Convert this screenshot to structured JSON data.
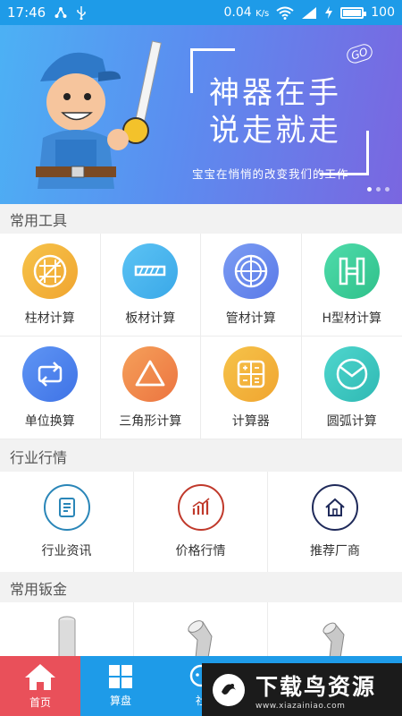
{
  "status_bar": {
    "time": "17:46",
    "speed": "0.04",
    "speed_unit": "K/s",
    "battery": "100"
  },
  "banner": {
    "headline_1": "神器在手",
    "headline_2": "说走就走",
    "tag": "GO",
    "subtitle": "宝宝在悄悄的改变我们的工作"
  },
  "sections": {
    "common_tools": "常用工具",
    "industry_market": "行业行情",
    "common_sheet_metal": "常用钣金"
  },
  "tools": [
    {
      "label": "柱材计算",
      "icon": "column-grid-icon",
      "color": "#f3b53f"
    },
    {
      "label": "板材计算",
      "icon": "plate-icon",
      "color": "#4bb6ee"
    },
    {
      "label": "管材计算",
      "icon": "pipe-icon",
      "color": "#6d8df0"
    },
    {
      "label": "H型材计算",
      "icon": "h-beam-icon",
      "color": "#3fcf9a"
    },
    {
      "label": "单位换算",
      "icon": "unit-convert-icon",
      "color": "#4e84ef"
    },
    {
      "label": "三角形计算",
      "icon": "triangle-icon",
      "color": "#f0894d"
    },
    {
      "label": "计算器",
      "icon": "calculator-icon",
      "color": "#f3b53f"
    },
    {
      "label": "圆弧计算",
      "icon": "arc-icon",
      "color": "#3ec6c0"
    }
  ],
  "market": [
    {
      "label": "行业资讯",
      "icon": "news-icon",
      "color": "#2a86b8"
    },
    {
      "label": "价格行情",
      "icon": "price-chart-icon",
      "color": "#c0392b"
    },
    {
      "label": "推荐厂商",
      "icon": "home-icon",
      "color": "#1f2a5a"
    }
  ],
  "tabbar": [
    {
      "label": "首页",
      "icon": "home-icon",
      "active": true
    },
    {
      "label": "算盘",
      "icon": "grid-icon",
      "active": false
    },
    {
      "label": "社",
      "icon": "community-icon",
      "active": false
    }
  ],
  "watermark": {
    "brand": "下载鸟资源",
    "url": "www.xiazainiao.com"
  }
}
